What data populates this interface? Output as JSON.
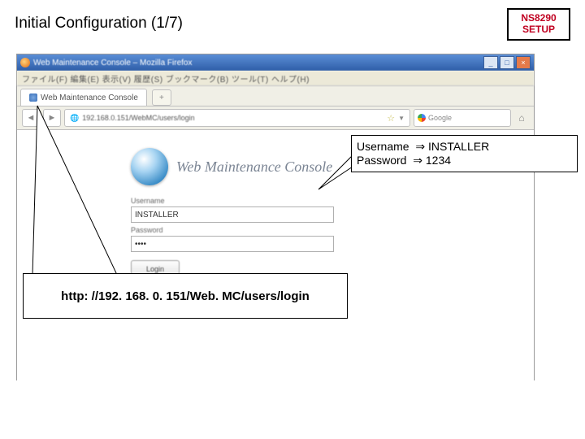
{
  "slide": {
    "title": "Initial Configuration  (1/7)",
    "badge_line1": "NS8290",
    "badge_line2": "SETUP"
  },
  "browser": {
    "window_title": "Web Maintenance Console – Mozilla Firefox",
    "menubar": "ファイル(F)  編集(E)  表示(V)  履歴(S)  ブックマーク(B)  ツール(T)  ヘルプ(H)",
    "tab_label": "Web Maintenance Console",
    "address": "192.168.0.151/WebMC/users/login",
    "search_placeholder": "Google",
    "page": {
      "brand": "Web Maintenance Console",
      "username_label": "Username",
      "username_value": "INSTALLER",
      "password_label": "Password",
      "password_value": "••••",
      "login_label": "Login"
    }
  },
  "callouts": {
    "credentials": {
      "l1a": "Username  ⇒",
      "l1b": "  INSTALLER",
      "l2a": "Password  ⇒",
      "l2b": "  1234"
    },
    "url": "http: //192. 168. 0. 151/Web. MC/users/login"
  }
}
